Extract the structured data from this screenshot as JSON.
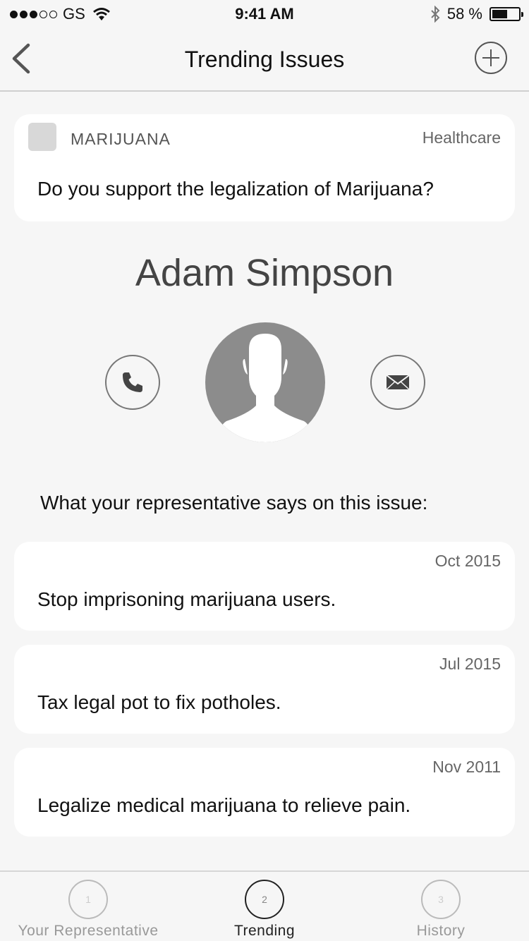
{
  "status_bar": {
    "carrier": "GS",
    "time": "9:41 AM",
    "battery_text": "58 %",
    "battery_level": 0.58
  },
  "nav": {
    "title": "Trending Issues",
    "back_icon": "chevron-left-icon",
    "add_icon": "plus-circle-icon"
  },
  "issue": {
    "tag": "MARIJUANA",
    "category": "Healthcare",
    "question": "Do you support the legalization of Marijuana?"
  },
  "representative": {
    "name": "Adam Simpson",
    "says_label": "What your representative says on this issue:"
  },
  "statements": [
    {
      "date": "Oct 2015",
      "text": "Stop imprisoning marijuana users."
    },
    {
      "date": "Jul 2015",
      "text": "Tax legal pot to fix potholes."
    },
    {
      "date": "Nov 2011",
      "text": "Legalize medical marijuana to relieve pain."
    }
  ],
  "tabs": [
    {
      "number": "1",
      "label": "Your Representative",
      "active": false
    },
    {
      "number": "2",
      "label": "Trending",
      "active": true
    },
    {
      "number": "3",
      "label": "History",
      "active": false
    }
  ]
}
